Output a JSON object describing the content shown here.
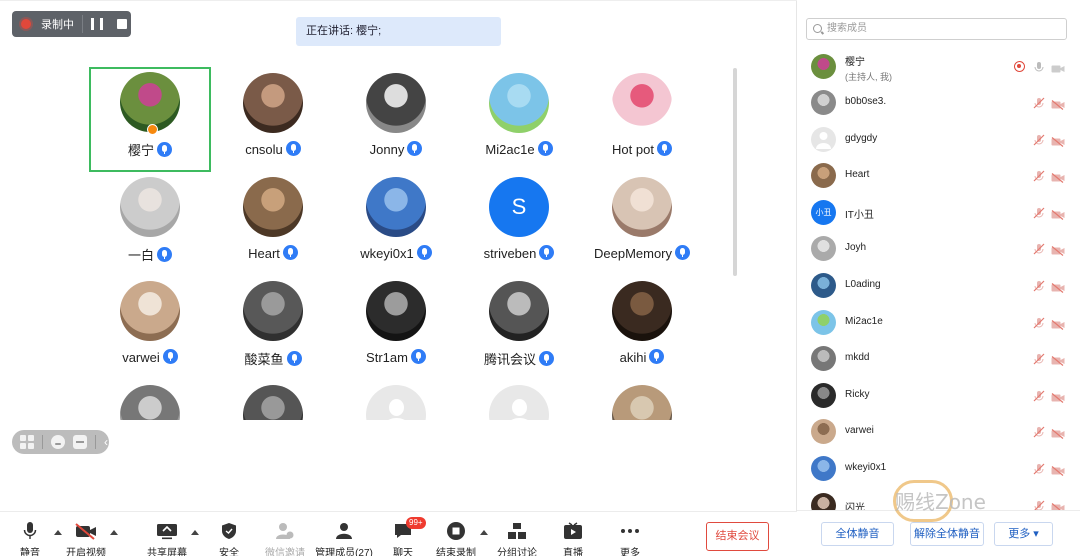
{
  "recording": {
    "label": "录制中"
  },
  "speaking": {
    "text": "正在讲话: 樱宁;"
  },
  "grid": {
    "tiles": [
      {
        "name": "樱宁",
        "colors": [
          "#6b8f3e",
          "#c04a8a",
          "#2d5a22"
        ],
        "active": true,
        "host": true
      },
      {
        "name": "cnsolu",
        "colors": [
          "#7a5a48",
          "#c49a7e",
          "#3c2a20"
        ]
      },
      {
        "name": "Jonny",
        "colors": [
          "#444",
          "#ddd",
          "#888"
        ]
      },
      {
        "name": "Mi2ac1e",
        "colors": [
          "#7cc4e8",
          "#a8dbf2",
          "#8fd06a"
        ]
      },
      {
        "name": "Hot pot",
        "colors": [
          "#f4c6d2",
          "#e65a7c",
          "#fff"
        ]
      },
      {
        "name": "一白",
        "colors": [
          "#ccc",
          "#e8e2de",
          "#a7a7a7"
        ]
      },
      {
        "name": "Heart",
        "colors": [
          "#8a6a4c",
          "#c8a07a",
          "#4d3826"
        ]
      },
      {
        "name": "wkeyi0x1",
        "colors": [
          "#3f78c8",
          "#8bb6e8",
          "#2a4b86"
        ]
      },
      {
        "name": "striveben",
        "letter": "S"
      },
      {
        "name": "DeepMemory",
        "colors": [
          "#d8c4b4",
          "#f0e0d4",
          "#9a7a6a"
        ]
      },
      {
        "name": "varwei",
        "colors": [
          "#caa98c",
          "#efe3d6",
          "#8d6d52"
        ]
      },
      {
        "name": "酸菜鱼",
        "colors": [
          "#585858",
          "#9a9a9a",
          "#303030"
        ]
      },
      {
        "name": "Str1am",
        "colors": [
          "#2c2c2c",
          "#9c9c9c",
          "#141414"
        ]
      },
      {
        "name": "腾讯会议",
        "colors": [
          "#555",
          "#bbb",
          "#222"
        ]
      },
      {
        "name": "akihi",
        "colors": [
          "#3a2a20",
          "#7a5a40",
          "#1a120c"
        ]
      },
      {
        "name": "",
        "colors": [
          "#777",
          "#ccc",
          "#999"
        ]
      },
      {
        "name": "",
        "colors": [
          "#555",
          "#999",
          "#333"
        ]
      },
      {
        "name": "",
        "gray": true
      },
      {
        "name": "",
        "gray": true
      },
      {
        "name": "",
        "colors": [
          "#b89a7a",
          "#d8c8b0",
          "#6a5a4a"
        ]
      }
    ]
  },
  "toolbar": {
    "items": [
      {
        "label": "静音",
        "icon": "mic-icon"
      },
      {
        "label": "开启视频",
        "icon": "video-off-icon"
      },
      {
        "label": "共享屏幕",
        "icon": "screen-share-icon"
      },
      {
        "label": "安全",
        "icon": "shield-icon"
      },
      {
        "label": "微信邀请",
        "icon": "invite-icon"
      },
      {
        "label": "管理成员(27)",
        "icon": "members-icon"
      },
      {
        "label": "聊天",
        "icon": "chat-icon",
        "badge": "99+"
      },
      {
        "label": "结束录制",
        "icon": "stop-record-icon"
      },
      {
        "label": "分组讨论",
        "icon": "breakout-icon"
      },
      {
        "label": "直播",
        "icon": "live-icon"
      },
      {
        "label": "更多",
        "icon": "more-icon"
      }
    ],
    "end_meeting": "结束会议"
  },
  "panel": {
    "search_placeholder": "搜索成员",
    "members": [
      {
        "name": "樱宁",
        "sub": "(主持人, 我)",
        "colors": [
          "#6b8f3e",
          "#c04a8a"
        ]
      },
      {
        "name": "b0b0se3.",
        "colors": [
          "#8a8a8a",
          "#d0d0d0"
        ]
      },
      {
        "name": "gdygdy",
        "gray": true
      },
      {
        "name": "Heart",
        "colors": [
          "#8a6a4c",
          "#c8a07a"
        ]
      },
      {
        "name": "IT小丑",
        "letter": "小丑"
      },
      {
        "name": "Joyh",
        "colors": [
          "#aaa",
          "#e0e0e0"
        ]
      },
      {
        "name": "L0ading",
        "colors": [
          "#2d5a8a",
          "#7ab0d8"
        ]
      },
      {
        "name": "Mi2ac1e",
        "colors": [
          "#7cc4e8",
          "#8fd06a"
        ]
      },
      {
        "name": "mkdd",
        "colors": [
          "#777",
          "#bbb"
        ]
      },
      {
        "name": "Ricky",
        "colors": [
          "#2a2a2a",
          "#888"
        ]
      },
      {
        "name": "varwei",
        "colors": [
          "#caa98c",
          "#8d6d52"
        ]
      },
      {
        "name": "wkeyi0x1",
        "colors": [
          "#3f78c8",
          "#8bb6e8"
        ]
      },
      {
        "name": "闪光",
        "colors": [
          "#3a2a20",
          "#c8b0a0"
        ]
      }
    ],
    "mute_all": "全体静音",
    "unmute_all": "解除全体静音",
    "more": "更多 ▾"
  },
  "watermark": "赐线Zone",
  "colors": {
    "accent": "#2f7cf6",
    "active_border": "#3dbb5f",
    "danger": "#e04a3e"
  }
}
